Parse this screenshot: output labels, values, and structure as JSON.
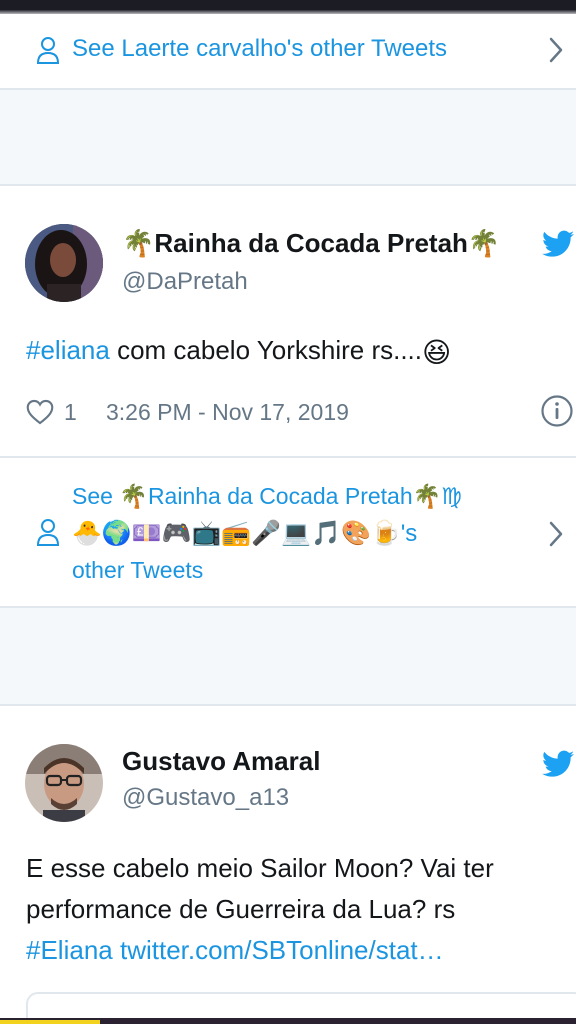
{
  "see_more_1": {
    "label": "See Laerte carvalho's other Tweets"
  },
  "tweet_1": {
    "name": "🌴Rainha da Cocada Pretah🌴",
    "handle": "@DaPretah",
    "hashtag": "#eliana",
    "text": " com cabelo Yorkshire rs....",
    "text_emoji": "😆",
    "like_count": "1",
    "timestamp": "3:26 PM - Nov 17, 2019"
  },
  "see_more_2": {
    "line1": "See 🌴Rainha da Cocada Pretah🌴♍",
    "line2": "🐣🌍💷🎮📺📻🎤💻🎵🎨🍺's",
    "line3": "other Tweets"
  },
  "tweet_2": {
    "name": "Gustavo Amaral",
    "handle": "@Gustavo_a13",
    "text_line1": "E esse cabelo meio Sailor Moon? Vai ter",
    "text_line2": "performance de Guerreira da Lua? rs",
    "hashtag": "#Eliana",
    "link": "twitter.com/SBTonline/stat…"
  },
  "colors": {
    "accent": "#1b95e0",
    "secondary_text": "#657786",
    "divider": "#e1e8ed",
    "gap_background": "#f5f8fa"
  },
  "icons": [
    "person-icon",
    "chevron-right-icon",
    "twitter-bird-icon",
    "heart-icon",
    "info-icon"
  ]
}
